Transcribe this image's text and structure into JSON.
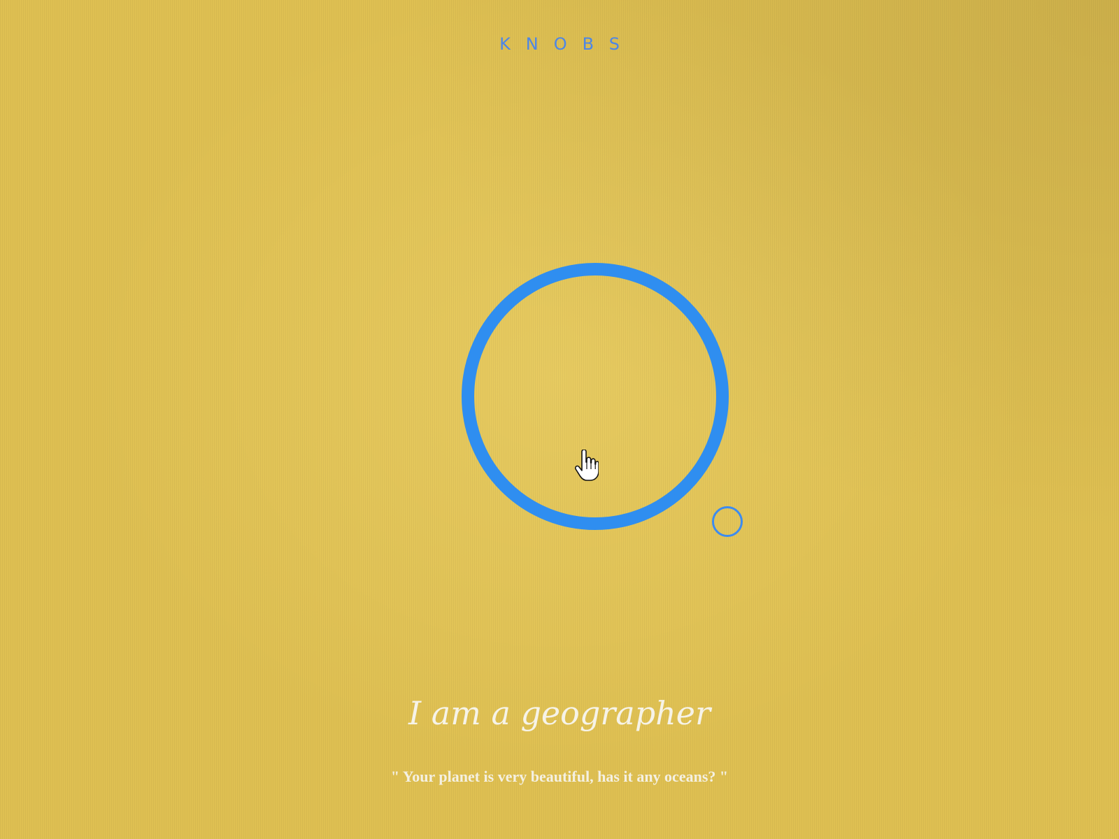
{
  "header": {
    "brand": "KNOBS"
  },
  "knob": {
    "ring_color": "#2f8ef0",
    "handle_color": "#3c8bf0"
  },
  "cursor": {
    "icon": "hand-pointer-icon"
  },
  "content": {
    "title": "I am a geographer",
    "quote": "\" Your planet is very beautiful, has it any oceans? \""
  },
  "colors": {
    "background": "#dfc052",
    "accent": "#4d86e6",
    "text": "#f6f3e8"
  }
}
